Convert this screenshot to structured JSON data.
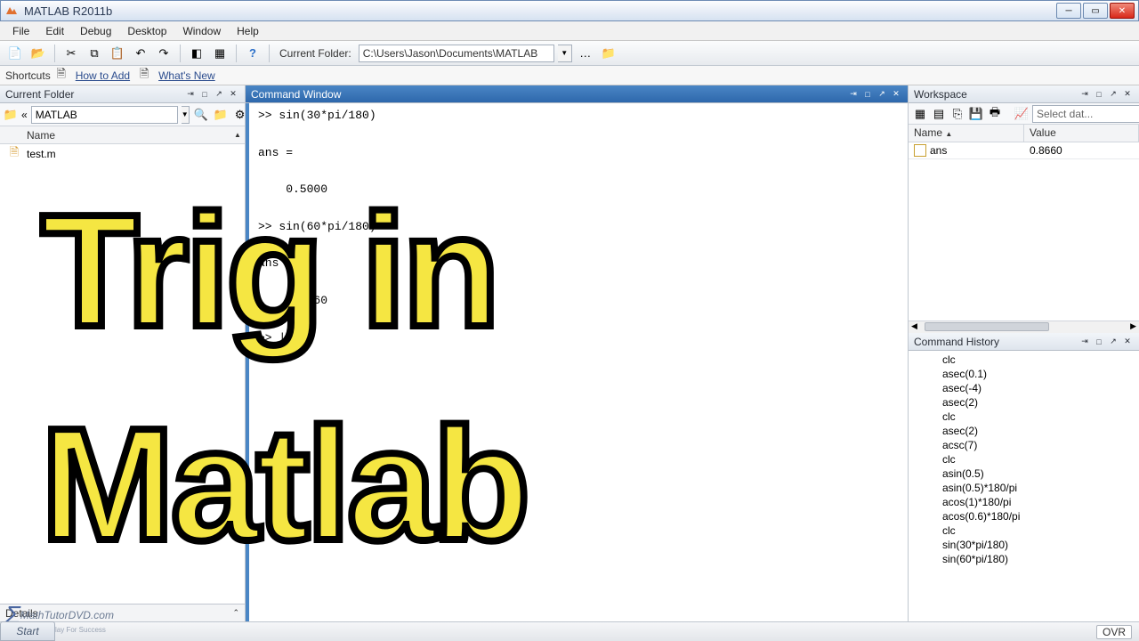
{
  "window": {
    "title": "MATLAB R2011b"
  },
  "menu": {
    "items": [
      "File",
      "Edit",
      "Debug",
      "Desktop",
      "Window",
      "Help"
    ]
  },
  "toolbar": {
    "folder_label": "Current Folder:",
    "folder_path": "C:\\Users\\Jason\\Documents\\MATLAB"
  },
  "shortcuts": {
    "label": "Shortcuts",
    "how_to_add": "How to Add",
    "whats_new": "What's New"
  },
  "current_folder": {
    "title": "Current Folder",
    "breadcrumb_prefix": "«",
    "breadcrumb": "MATLAB",
    "column": "Name",
    "files": [
      "test.m"
    ],
    "details": "Details"
  },
  "command_window": {
    "title": "Command Window",
    "lines": [
      ">> sin(30*pi/180)",
      "",
      "ans =",
      "",
      "    0.5000",
      "",
      ">> sin(60*pi/180)",
      "",
      "ans =",
      "",
      "    0.8660",
      "",
      ">> |"
    ]
  },
  "workspace": {
    "title": "Workspace",
    "select_placeholder": "Select dat...",
    "col1": "Name",
    "col2": "Value",
    "rows": [
      {
        "name": "ans",
        "value": "0.8660"
      }
    ]
  },
  "command_history": {
    "title": "Command History",
    "lines": [
      "clc",
      "asec(0.1)",
      "asec(-4)",
      "asec(2)",
      "clc",
      "asec(2)",
      "acsc(7)",
      "clc",
      "asin(0.5)",
      "asin(0.5)*180/pi",
      "acos(1)*180/pi",
      "acos(0.6)*180/pi",
      "clc",
      "sin(30*pi/180)",
      "sin(60*pi/180)"
    ]
  },
  "status": {
    "ovr": "OVR"
  },
  "overlay": {
    "line1": "Trig in",
    "line2": "Matlab"
  },
  "watermark": {
    "brand": "MathTutorDVD",
    "suffix": ".com",
    "tag": "Press Play For Success"
  },
  "taskbar": {
    "start": "Start"
  }
}
